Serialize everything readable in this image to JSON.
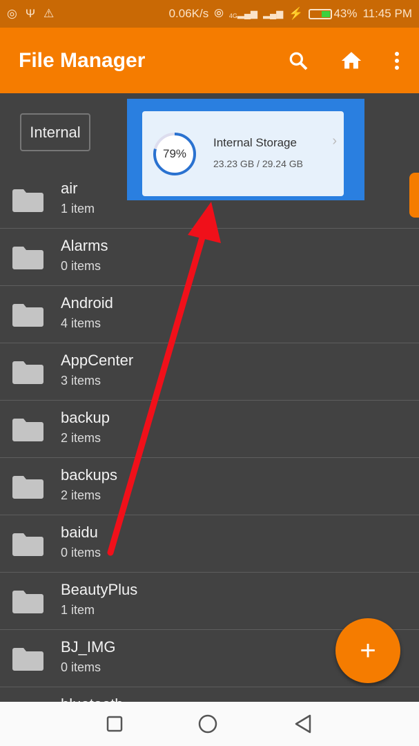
{
  "status_bar": {
    "icons": [
      "instagram-icon",
      "usb-icon",
      "warning-icon"
    ],
    "speed": "0.06K/s",
    "network": "4G",
    "battery": "43%",
    "battery_level": 43,
    "time": "11:45 PM"
  },
  "app_bar": {
    "title": "File Manager",
    "actions": [
      "search-icon",
      "home-icon",
      "more-vert-icon"
    ]
  },
  "storage_tab": "Internal",
  "storage_card": {
    "percent_label": "79%",
    "percent": 79,
    "title": "Internal Storage",
    "size": "23.23 GB / 29.24 GB"
  },
  "folders": [
    {
      "name": "air",
      "count": "1 item"
    },
    {
      "name": "Alarms",
      "count": "0 items"
    },
    {
      "name": "Android",
      "count": "4 items"
    },
    {
      "name": "AppCenter",
      "count": "3 items"
    },
    {
      "name": "backup",
      "count": "2 items"
    },
    {
      "name": "backups",
      "count": "2 items"
    },
    {
      "name": "baidu",
      "count": "0 items"
    },
    {
      "name": "BeautyPlus",
      "count": "1 item"
    },
    {
      "name": "BJ_IMG",
      "count": "0 items"
    },
    {
      "name": "bluetooth",
      "count": ""
    }
  ],
  "fab": "+",
  "colors": {
    "accent": "#f57c00",
    "status": "#c96905",
    "background": "#424242",
    "arrow": "#f0101a"
  }
}
